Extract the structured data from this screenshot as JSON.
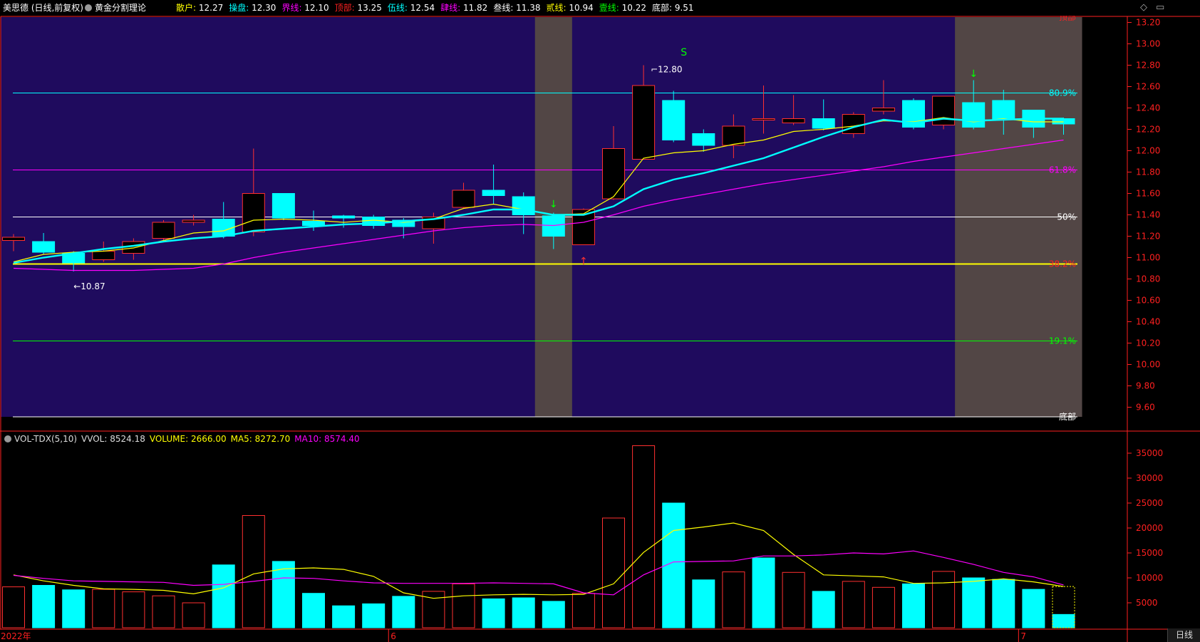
{
  "header": {
    "stock_name": "美思德 (日线,前复权)",
    "indicator_name": "黄金分割理论",
    "lines": [
      {
        "label": "散户:",
        "value": "12.27",
        "color": "#ffff00"
      },
      {
        "label": "操盘:",
        "value": "12.30",
        "color": "#00ffff"
      },
      {
        "label": "界线:",
        "value": "12.10",
        "color": "#ff00ff"
      },
      {
        "label": "顶部:",
        "value": "13.25",
        "color": "#ff2020"
      },
      {
        "label": "伍线:",
        "value": "12.54",
        "color": "#00ffff"
      },
      {
        "label": "肆线:",
        "value": "11.82",
        "color": "#ff00ff"
      },
      {
        "label": "叁线:",
        "value": "11.38",
        "color": "#ffffff"
      },
      {
        "label": "贰线:",
        "value": "10.94",
        "color": "#ffff00"
      },
      {
        "label": "壹线:",
        "value": "10.22",
        "color": "#00ff00"
      },
      {
        "label": "底部:",
        "value": "9.51",
        "color": "#ffffff"
      }
    ]
  },
  "volume_header": {
    "name": "VOL-TDX(5,10)",
    "vvol": "VVOL: 8524.18",
    "volume": "VOLUME: 2666.00",
    "ma5": "MA5: 8272.70",
    "ma10": "MA10: 8574.40"
  },
  "colors": {
    "price_bg": "#1f0b5e",
    "shade": "#524645",
    "up": "#ff3030",
    "down": "#00ffff",
    "ma_short": "#ffff00",
    "ma_mid": "#00ffff",
    "ma_long": "#ff00ff",
    "axis": "#ff2020"
  },
  "chart_data": [
    {
      "type": "candlestick",
      "title": "黄金分割理论",
      "ylim": [
        9.51,
        13.25
      ],
      "y_ticks": [
        "13.20",
        "13.00",
        "12.80",
        "12.60",
        "12.40",
        "12.20",
        "12.00",
        "11.80",
        "11.60",
        "11.40",
        "11.20",
        "11.00",
        "10.80",
        "10.60",
        "10.40",
        "10.20",
        "10.00",
        "9.80",
        "9.60"
      ],
      "fib_levels": [
        {
          "value": 13.25,
          "label": "顶部",
          "color": "#ff2020"
        },
        {
          "value": 12.54,
          "label": "80.9%",
          "color": "#00ffff"
        },
        {
          "value": 11.82,
          "label": "61.8%",
          "color": "#ff00ff"
        },
        {
          "value": 11.38,
          "label": "50%",
          "color": "#ffffff"
        },
        {
          "value": 10.94,
          "label": "38.2%",
          "color": "#ffff00",
          "label_color": "#ff2020"
        },
        {
          "value": 10.22,
          "label": "19.1%",
          "color": "#00ff00"
        },
        {
          "value": 9.51,
          "label": "底部",
          "color": "#ffffff"
        }
      ],
      "candles": [
        {
          "o": 11.16,
          "c": 11.19,
          "h": 11.22,
          "l": 11.06
        },
        {
          "o": 11.15,
          "c": 11.05,
          "h": 11.23,
          "l": 11.03
        },
        {
          "o": 11.04,
          "c": 10.95,
          "h": 11.06,
          "l": 10.87
        },
        {
          "o": 10.98,
          "c": 11.06,
          "h": 11.15,
          "l": 10.96
        },
        {
          "o": 11.04,
          "c": 11.15,
          "h": 11.18,
          "l": 10.98
        },
        {
          "o": 11.18,
          "c": 11.33,
          "h": 11.35,
          "l": 11.16
        },
        {
          "o": 11.33,
          "c": 11.35,
          "h": 11.4,
          "l": 11.3
        },
        {
          "o": 11.36,
          "c": 11.2,
          "h": 11.52,
          "l": 11.18
        },
        {
          "o": 11.24,
          "c": 11.6,
          "h": 12.02,
          "l": 11.2
        },
        {
          "o": 11.6,
          "c": 11.37,
          "h": 11.6,
          "l": 11.35
        },
        {
          "o": 11.34,
          "c": 11.3,
          "h": 11.44,
          "l": 11.25
        },
        {
          "o": 11.39,
          "c": 11.37,
          "h": 11.4,
          "l": 11.28
        },
        {
          "o": 11.38,
          "c": 11.3,
          "h": 11.4,
          "l": 11.27
        },
        {
          "o": 11.35,
          "c": 11.29,
          "h": 11.37,
          "l": 11.18
        },
        {
          "o": 11.27,
          "c": 11.38,
          "h": 11.42,
          "l": 11.13
        },
        {
          "o": 11.47,
          "c": 11.63,
          "h": 11.7,
          "l": 11.46
        },
        {
          "o": 11.63,
          "c": 11.58,
          "h": 11.87,
          "l": 11.5
        },
        {
          "o": 11.57,
          "c": 11.4,
          "h": 11.61,
          "l": 11.22
        },
        {
          "o": 11.39,
          "c": 11.2,
          "h": 11.42,
          "l": 11.08
        },
        {
          "o": 11.12,
          "c": 11.45,
          "h": 11.46,
          "l": 11.12
        },
        {
          "o": 11.55,
          "c": 12.02,
          "h": 12.23,
          "l": 11.54
        },
        {
          "o": 11.92,
          "c": 12.61,
          "h": 12.8,
          "l": 11.92
        },
        {
          "o": 12.47,
          "c": 12.1,
          "h": 12.56,
          "l": 12.08
        },
        {
          "o": 12.16,
          "c": 12.05,
          "h": 12.2,
          "l": 11.99
        },
        {
          "o": 12.05,
          "c": 12.23,
          "h": 12.34,
          "l": 11.93
        },
        {
          "o": 12.3,
          "c": 12.3,
          "h": 12.61,
          "l": 12.16
        },
        {
          "o": 12.26,
          "c": 12.3,
          "h": 12.52,
          "l": 12.24
        },
        {
          "o": 12.3,
          "c": 12.21,
          "h": 12.48,
          "l": 12.19
        },
        {
          "o": 12.16,
          "c": 12.34,
          "h": 12.36,
          "l": 12.12
        },
        {
          "o": 12.37,
          "c": 12.4,
          "h": 12.66,
          "l": 12.34
        },
        {
          "o": 12.47,
          "c": 12.22,
          "h": 12.49,
          "l": 12.2
        },
        {
          "o": 12.24,
          "c": 12.51,
          "h": 12.51,
          "l": 12.2
        },
        {
          "o": 12.45,
          "c": 12.22,
          "h": 12.66,
          "l": 12.2
        },
        {
          "o": 12.47,
          "c": 12.29,
          "h": 12.57,
          "l": 12.15
        },
        {
          "o": 12.38,
          "c": 12.22,
          "h": 12.38,
          "l": 12.12
        },
        {
          "o": 12.3,
          "c": 12.25,
          "h": 12.31,
          "l": 12.15
        }
      ],
      "series": [
        {
          "name": "散户",
          "values": [
            10.96,
            11.03,
            11.05,
            11.06,
            11.09,
            11.16,
            11.23,
            11.25,
            11.35,
            11.36,
            11.35,
            11.33,
            11.35,
            11.33,
            11.36,
            11.46,
            11.5,
            11.45,
            11.4,
            11.41,
            11.57,
            11.93,
            11.98,
            12.0,
            12.06,
            12.1,
            12.18,
            12.2,
            12.23,
            12.28,
            12.27,
            12.31,
            12.27,
            12.3,
            12.27,
            12.27
          ]
        },
        {
          "name": "操盘",
          "values": [
            10.95,
            11.0,
            11.04,
            11.08,
            11.11,
            11.15,
            11.18,
            11.2,
            11.25,
            11.27,
            11.29,
            11.31,
            11.32,
            11.34,
            11.36,
            11.4,
            11.45,
            11.45,
            11.4,
            11.4,
            11.48,
            11.64,
            11.73,
            11.79,
            11.86,
            11.93,
            12.03,
            12.13,
            12.22,
            12.29,
            12.26,
            12.3,
            12.28,
            12.29,
            12.3,
            12.3
          ]
        },
        {
          "name": "界线",
          "values": [
            10.9,
            10.89,
            10.88,
            10.88,
            10.88,
            10.89,
            10.9,
            10.94,
            11.0,
            11.05,
            11.09,
            11.13,
            11.17,
            11.21,
            11.25,
            11.28,
            11.3,
            11.31,
            11.3,
            11.33,
            11.4,
            11.48,
            11.54,
            11.59,
            11.64,
            11.69,
            11.73,
            11.77,
            11.81,
            11.85,
            11.9,
            11.94,
            11.98,
            12.02,
            12.06,
            12.1
          ]
        }
      ],
      "annotations": [
        {
          "text": "12.80",
          "bar": 21,
          "value": 12.8
        },
        {
          "text": "10.87",
          "bar": 2,
          "value": 10.87
        },
        {
          "text": "S",
          "bar": 22,
          "value": 13.0,
          "color": "#00ff00"
        }
      ],
      "arrows": [
        {
          "bar": 18,
          "dir": "down",
          "color": "#00ff00"
        },
        {
          "bar": 19,
          "dir": "up",
          "color": "#ff3030"
        },
        {
          "bar": 32,
          "dir": "down",
          "color": "#00ff00"
        }
      ],
      "shaded_ranges": [
        [
          18,
          18
        ],
        [
          32,
          35
        ]
      ]
    },
    {
      "type": "bar",
      "title": "VOL-TDX(5,10)",
      "ylim": [
        0,
        38000
      ],
      "y_ticks": [
        "35000",
        "30000",
        "25000",
        "20000",
        "15000",
        "10000",
        "5000"
      ],
      "x_labels": [
        {
          "bar": 0,
          "text": "2022年"
        },
        {
          "bar": 13,
          "text": "6"
        },
        {
          "bar": 34,
          "text": "7"
        }
      ],
      "values": [
        8200,
        8500,
        7600,
        7700,
        7200,
        6400,
        5000,
        12600,
        22500,
        13300,
        6900,
        4400,
        4800,
        6300,
        7300,
        8800,
        5800,
        6000,
        5300,
        6900,
        22000,
        36500,
        25000,
        9600,
        11200,
        14000,
        11100,
        7300,
        9300,
        8100,
        8800,
        11300,
        10000,
        9700,
        7700,
        2666
      ],
      "up": [
        true,
        false,
        false,
        true,
        true,
        true,
        true,
        false,
        true,
        false,
        false,
        false,
        false,
        false,
        true,
        true,
        false,
        false,
        false,
        true,
        true,
        true,
        false,
        false,
        true,
        false,
        true,
        false,
        true,
        true,
        false,
        true,
        false,
        false,
        false,
        false
      ],
      "series": [
        {
          "name": "MA5",
          "values": [
            10600,
            9400,
            8500,
            7800,
            7700,
            7500,
            6800,
            8000,
            10800,
            11800,
            12000,
            11700,
            10300,
            7000,
            5900,
            6400,
            6600,
            6700,
            6600,
            6700,
            8800,
            15100,
            19500,
            20200,
            21000,
            19500,
            14700,
            10600,
            10400,
            10200,
            8900,
            9000,
            9300,
            9800,
            9200,
            8272
          ]
        },
        {
          "name": "MA10",
          "values": [
            10500,
            9900,
            9400,
            9300,
            9200,
            9100,
            8500,
            8700,
            9300,
            10000,
            9900,
            9400,
            9000,
            8900,
            8900,
            8900,
            9000,
            8900,
            8800,
            7000,
            6600,
            10600,
            13200,
            13300,
            13400,
            14400,
            14400,
            14600,
            15000,
            14800,
            15400,
            14100,
            12700,
            11100,
            10200,
            8574
          ]
        }
      ]
    }
  ]
}
